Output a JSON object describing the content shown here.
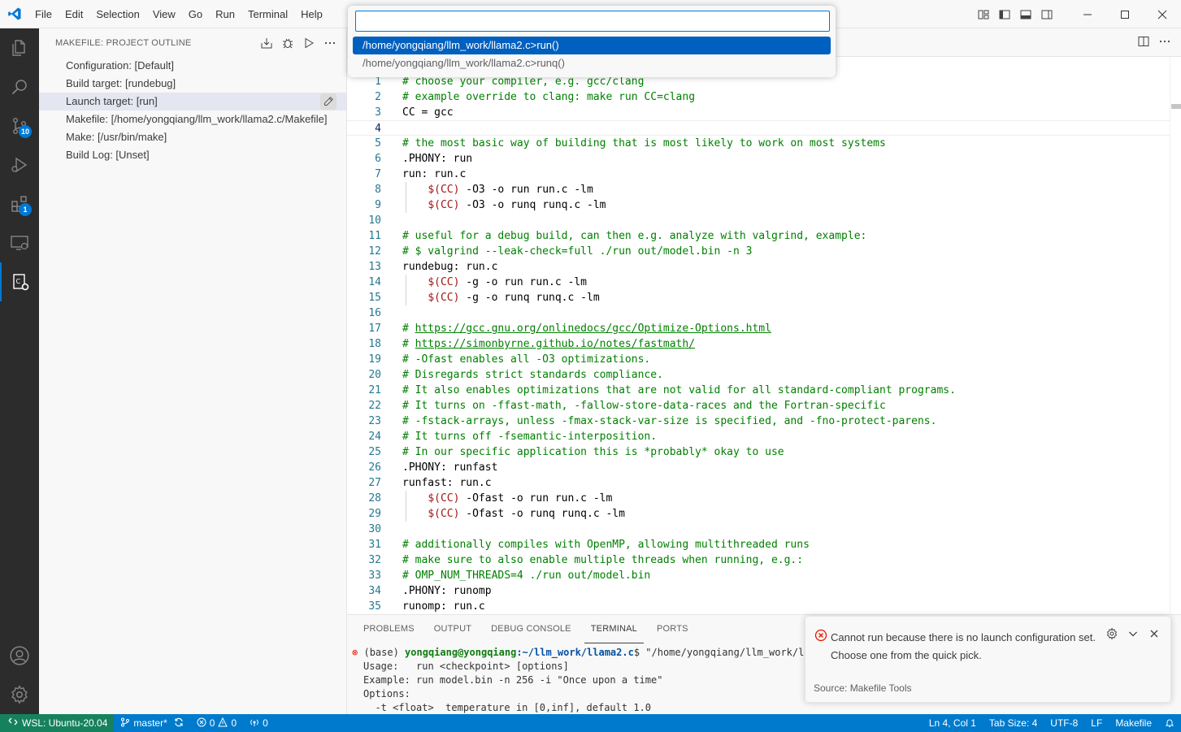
{
  "menu": [
    "File",
    "Edit",
    "Selection",
    "View",
    "Go",
    "Run",
    "Terminal",
    "Help"
  ],
  "activity_bar": {
    "source_control_badge": "10",
    "extensions_badge": "1"
  },
  "sidebar": {
    "title": "MAKEFILE: PROJECT OUTLINE",
    "items": [
      "Configuration: [Default]",
      "Build target: [rundebug]",
      "Launch target: [run]",
      "Makefile: [/home/yongqiang/llm_work/llama2.c/Makefile]",
      "Make: [/usr/bin/make]",
      "Build Log: [Unset]"
    ]
  },
  "quick_pick": {
    "input_value": "",
    "items": [
      "/home/yongqiang/llm_work/llama2.c>run()",
      "/home/yongqiang/llm_work/llama2.c>runq()"
    ]
  },
  "editor": {
    "lines": [
      "# choose your compiler, e.g. gcc/clang",
      "# example override to clang: make run CC=clang",
      "CC = gcc",
      "",
      "# the most basic way of building that is most likely to work on most systems",
      ".PHONY: run",
      "run: run.c",
      "    $(CC) -O3 -o run run.c -lm",
      "    $(CC) -O3 -o runq runq.c -lm",
      "",
      "# useful for a debug build, can then e.g. analyze with valgrind, example:",
      "# $ valgrind --leak-check=full ./run out/model.bin -n 3",
      "rundebug: run.c",
      "    $(CC) -g -o run run.c -lm",
      "    $(CC) -g -o runq runq.c -lm",
      "",
      "# https://gcc.gnu.org/onlinedocs/gcc/Optimize-Options.html",
      "# https://simonbyrne.github.io/notes/fastmath/",
      "# -Ofast enables all -O3 optimizations.",
      "# Disregards strict standards compliance.",
      "# It also enables optimizations that are not valid for all standard-compliant programs.",
      "# It turns on -ffast-math, -fallow-store-data-races and the Fortran-specific",
      "# -fstack-arrays, unless -fmax-stack-var-size is specified, and -fno-protect-parens.",
      "# It turns off -fsemantic-interposition.",
      "# In our specific application this is *probably* okay to use",
      ".PHONY: runfast",
      "runfast: run.c",
      "    $(CC) -Ofast -o run run.c -lm",
      "    $(CC) -Ofast -o runq runq.c -lm",
      "",
      "# additionally compiles with OpenMP, allowing multithreaded runs",
      "# make sure to also enable multiple threads when running, e.g.:",
      "# OMP_NUM_THREADS=4 ./run out/model.bin",
      ".PHONY: runomp",
      "runomp: run.c"
    ]
  },
  "panel": {
    "tabs": [
      "PROBLEMS",
      "OUTPUT",
      "DEBUG CONSOLE",
      "TERMINAL",
      "PORTS"
    ],
    "active_tab": "TERMINAL",
    "terminal": {
      "prompt_env": "(base) ",
      "prompt_user": "yongqiang@yongqiang",
      "prompt_path": ":~/llm_work/llama2.c",
      "prompt_cmd": "$ \"/home/yongqiang/llm_work/llam",
      "lines": [
        "Usage:   run <checkpoint> [options]",
        "Example: run model.bin -n 256 -i \"Once upon a time\"",
        "Options:",
        "  -t <float>  temperature in [0,inf], default 1.0"
      ]
    }
  },
  "notification": {
    "line1": "Cannot run because there is no launch configuration set.",
    "line2": "Choose one from the quick pick.",
    "source": "Source: Makefile Tools"
  },
  "status_bar": {
    "remote": "WSL: Ubuntu-20.04",
    "branch": "master*",
    "errors": "0",
    "warnings": "0",
    "ports": "0",
    "position": "Ln 4, Col 1",
    "tab_size": "Tab Size: 4",
    "encoding": "UTF-8",
    "eol": "LF",
    "language": "Makefile"
  },
  "colors": {
    "accent": "#0078d4",
    "statusbar": "#007acc",
    "remote": "#16825d",
    "comment": "#008000",
    "error": "#e51400"
  }
}
